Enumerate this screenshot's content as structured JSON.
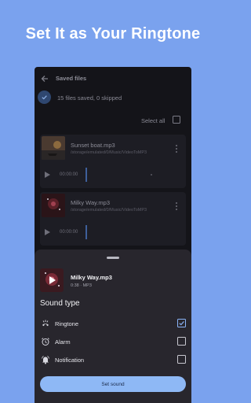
{
  "headline": "Set It as Your Ringtone",
  "screen": {
    "title": "Saved files",
    "summary": "15 files saved, 0 skipped",
    "select_all": "Select all"
  },
  "files": [
    {
      "name": "Sunset boat.mp3",
      "path": "/storage/emulated/0/Music/VideoToMP3",
      "time": "00:00:00"
    },
    {
      "name": "Milky Way.mp3",
      "path": "/storage/emulated/0/Music/VideoToMP3",
      "time": "00:00:00"
    }
  ],
  "sheet": {
    "title": "Milky Way.mp3",
    "meta": "0:38 · MP3",
    "section_title": "Sound type",
    "options": [
      {
        "label": "Ringtone",
        "icon": "ringtone-icon",
        "checked": true
      },
      {
        "label": "Alarm",
        "icon": "alarm-clock-icon",
        "checked": false
      },
      {
        "label": "Notification",
        "icon": "notification-bell-icon",
        "checked": false
      }
    ],
    "button": "Set sound"
  },
  "colors": {
    "background": "#7aa2ee",
    "accent": "#8ab4f8",
    "sheet": "#28262d",
    "screen": "#141419"
  }
}
